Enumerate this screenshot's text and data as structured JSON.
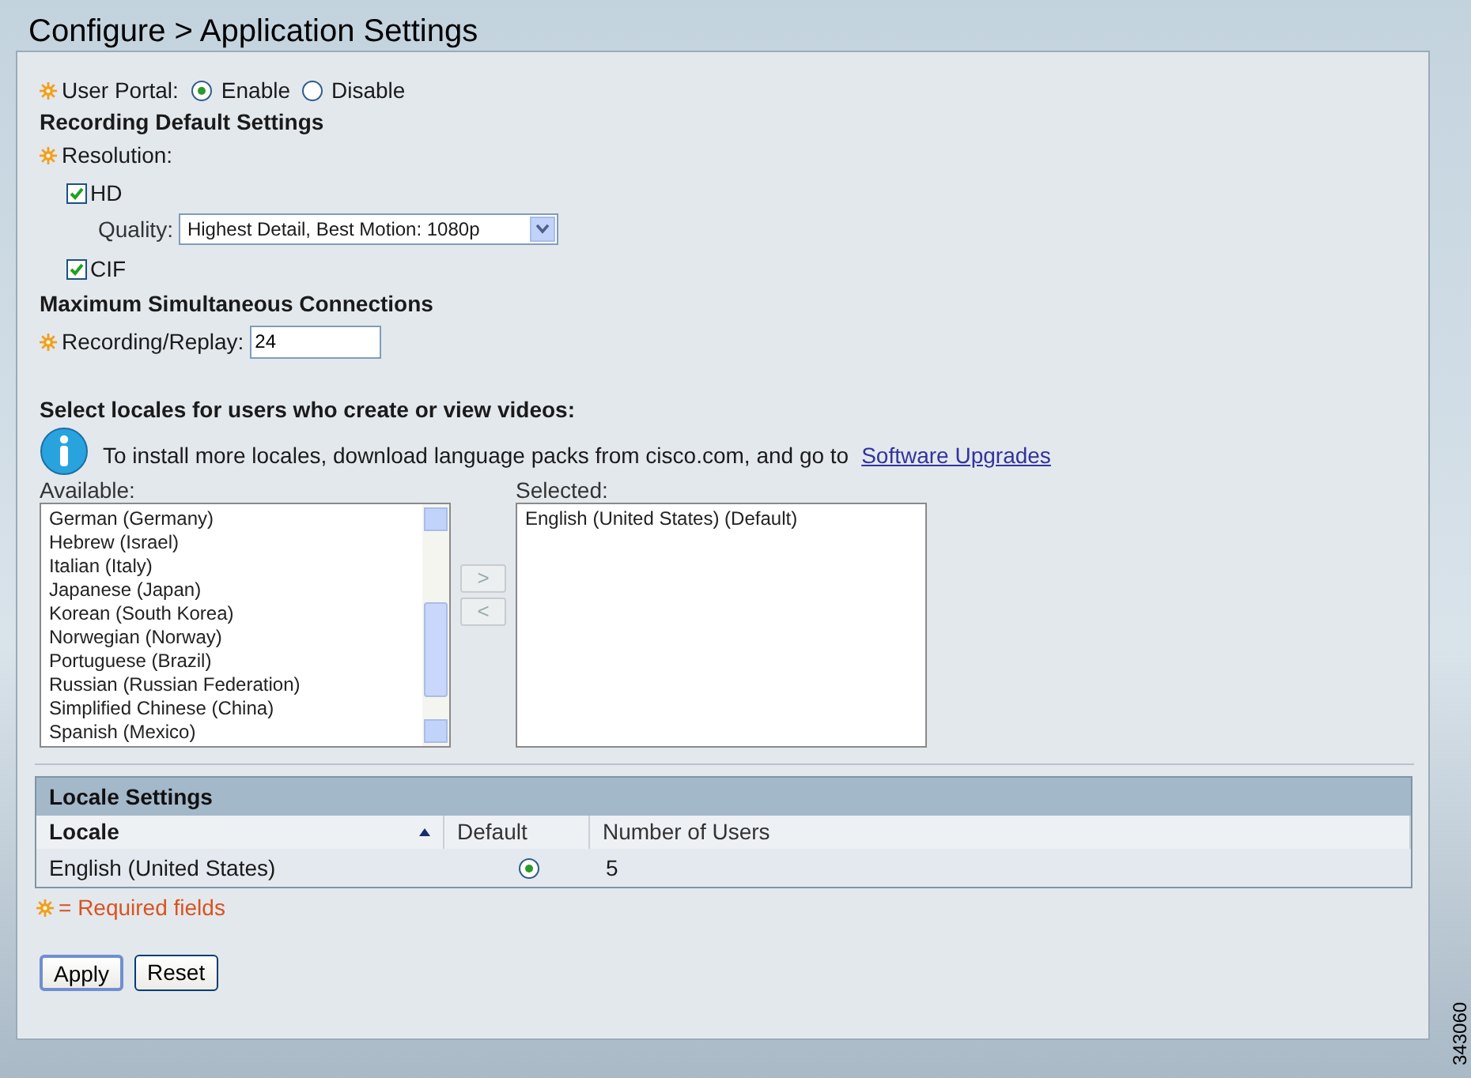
{
  "page_title": "Configure > Application Settings",
  "user_portal": {
    "label": "User Portal:",
    "required": true,
    "options": [
      {
        "label": "Enable",
        "selected": true
      },
      {
        "label": "Disable",
        "selected": false
      }
    ]
  },
  "recording_defaults": {
    "heading": "Recording Default Settings",
    "resolution": {
      "label": "Resolution:",
      "required": true
    },
    "hd": {
      "label": "HD",
      "checked": true
    },
    "quality": {
      "label": "Quality:",
      "value": "Highest Detail, Best Motion: 1080p"
    },
    "cif": {
      "label": "CIF",
      "checked": true
    }
  },
  "max_connections": {
    "heading": "Maximum Simultaneous Connections",
    "label": "Recording/Replay:",
    "required": true,
    "value": "24"
  },
  "locales": {
    "heading": "Select locales for users who create or view videos:",
    "info_text": "To install more locales, download language packs from cisco.com, and go to",
    "link": "Software Upgrades",
    "available_label": "Available:",
    "available": [
      "German (Germany)",
      "Hebrew (Israel)",
      "Italian (Italy)",
      "Japanese (Japan)",
      "Korean (South Korea)",
      "Norwegian (Norway)",
      "Portuguese (Brazil)",
      "Russian (Russian Federation)",
      "Simplified Chinese (China)",
      "Spanish (Mexico)"
    ],
    "add_button": ">",
    "remove_button": "<",
    "selected_label": "Selected:",
    "selected": [
      "English (United States) (Default)"
    ]
  },
  "locale_settings": {
    "title": "Locale Settings",
    "columns": [
      {
        "label": "Locale",
        "sorted": true
      },
      {
        "label": "Default",
        "sorted": false
      },
      {
        "label": "Number of Users",
        "sorted": false
      }
    ],
    "rows": [
      {
        "locale": "English (United States)",
        "default": true,
        "users": "5"
      }
    ]
  },
  "required_note": "= Required fields",
  "buttons": [
    {
      "label": "Apply",
      "focused": true
    },
    {
      "label": "Reset",
      "focused": false
    }
  ],
  "figure_id": "343060"
}
